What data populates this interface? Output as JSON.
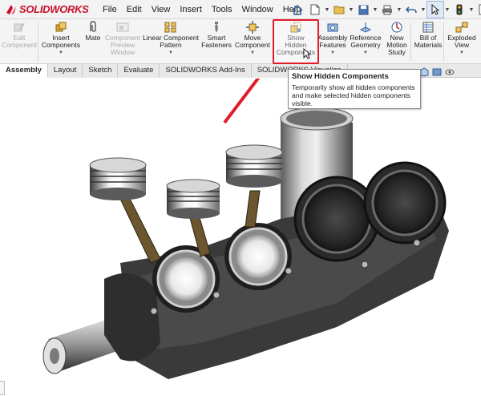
{
  "app": {
    "logo_text": "SOLIDWORKS",
    "logo_prefix": "3DS",
    "brand_color": "#c8102e"
  },
  "menu": {
    "items": [
      "File",
      "Edit",
      "View",
      "Insert",
      "Tools",
      "Window",
      "Help"
    ]
  },
  "ribbon": {
    "commands": [
      {
        "label": "Edit\nComponent",
        "enabled": false,
        "icon": "edit-component-icon"
      },
      {
        "label": "Insert\nComponents",
        "enabled": true,
        "icon": "insert-components-icon"
      },
      {
        "label": "Mate",
        "enabled": true,
        "icon": "mate-icon"
      },
      {
        "label": "Component\nPreview\nWindow",
        "enabled": false,
        "icon": "component-preview-icon"
      },
      {
        "label": "Linear Component\nPattern",
        "enabled": true,
        "icon": "linear-pattern-icon"
      },
      {
        "label": "Smart\nFasteners",
        "enabled": true,
        "icon": "smart-fasteners-icon"
      },
      {
        "label": "Move\nComponent",
        "enabled": true,
        "icon": "move-component-icon"
      },
      {
        "label": "Show\nHidden\nComponents",
        "enabled": true,
        "icon": "show-hidden-icon"
      },
      {
        "label": "Assembly\nFeatures",
        "enabled": true,
        "icon": "assembly-features-icon"
      },
      {
        "label": "Reference\nGeometry",
        "enabled": true,
        "icon": "reference-geometry-icon"
      },
      {
        "label": "New\nMotion\nStudy",
        "enabled": true,
        "icon": "motion-study-icon"
      },
      {
        "label": "Bill of\nMaterials",
        "enabled": true,
        "icon": "bom-icon"
      },
      {
        "label": "Exploded\nView",
        "enabled": true,
        "icon": "exploded-view-icon"
      }
    ]
  },
  "tabs": [
    "Assembly",
    "Layout",
    "Sketch",
    "Evaluate",
    "SOLIDWORKS Add-Ins",
    "SOLIDWORKS Visualize"
  ],
  "active_tab": "Assembly",
  "tooltip": {
    "title": "Show Hidden Components",
    "body": "Temporarily show all hidden components and make selected hidden components visible."
  },
  "colors": {
    "highlight": "#e11d2b",
    "annotation_arrow": "#e11d2b"
  }
}
